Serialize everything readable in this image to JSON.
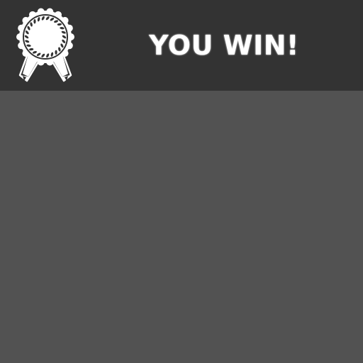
{
  "banner": {
    "title": "YOU WIN!",
    "icon": "award-ribbon-icon"
  },
  "colors": {
    "banner_background": "#333333",
    "play_area_background": "#525252",
    "title_text": "#ffffff",
    "icon_fill": "#ffffff",
    "icon_laurel": "#333333"
  }
}
